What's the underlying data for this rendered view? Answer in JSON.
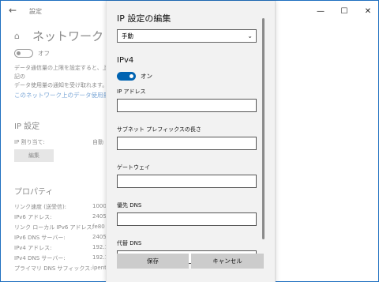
{
  "window": {
    "app_title": "設定"
  },
  "background": {
    "page_title": "ネットワーク",
    "metered_toggle_label": "オフ",
    "description": "データ通信量の上限を設定すると、上記の",
    "description_line2": "データ使用量の通知を受け取れます。",
    "usage_link": "このネットワーク上のデータ使用量を制限",
    "ip_settings_header": "IP 設定",
    "ip_assignment_label": "IP 割り当て:",
    "ip_assignment_value": "自動",
    "edit_button": "編集",
    "properties_header": "プロパティ",
    "properties": [
      {
        "key": "リンク速度 (送受信):",
        "value": "1000"
      },
      {
        "key": "IPv6 アドレス:",
        "value": "2405"
      },
      {
        "key": "リンク ローカル IPv6 アドレス:",
        "value": "fe80"
      },
      {
        "key": "IPv6 DNS サーバー:",
        "value": "2405"
      },
      {
        "key": "IPv4 アドレス:",
        "value": "192.1"
      },
      {
        "key": "IPv4 DNS サーバー:",
        "value": "192.1"
      },
      {
        "key": "プライマリ DNS サフィックス:",
        "value": "ipent"
      }
    ]
  },
  "dialog": {
    "title": "IP 設定の編集",
    "mode_select": "手動",
    "ipv4_header": "IPv4",
    "ipv4_toggle_label": "オン",
    "fields": [
      {
        "label": "IP アドレス",
        "value": ""
      },
      {
        "label": "サブネット プレフィックスの長さ",
        "value": ""
      },
      {
        "label": "ゲートウェイ",
        "value": ""
      },
      {
        "label": "優先 DNS",
        "value": ""
      },
      {
        "label": "代替 DNS",
        "value": ""
      }
    ],
    "save_button": "保存",
    "cancel_button": "キャンセル"
  },
  "colors": {
    "accent": "#0063b1",
    "link": "#7aa6d6",
    "frame": "#1e6fbf"
  }
}
